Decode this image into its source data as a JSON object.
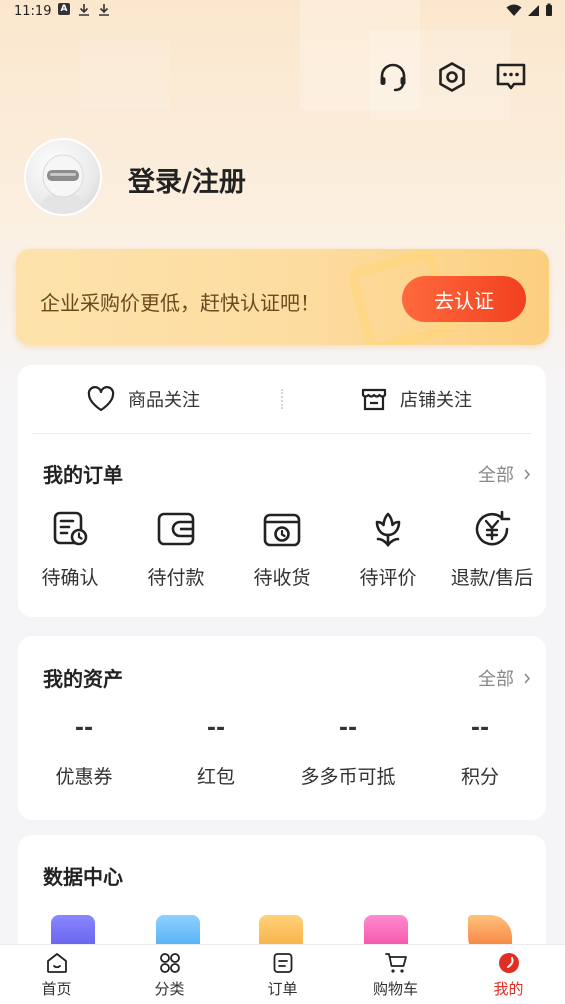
{
  "status_bar": {
    "time": "11:19"
  },
  "profile": {
    "login_text": "登录/注册"
  },
  "banner": {
    "text": "企业采购价更低，赶快认证吧！",
    "button": "去认证"
  },
  "follow": {
    "goods": "商品关注",
    "store": "店铺关注"
  },
  "orders": {
    "title": "我的订单",
    "more": "全部",
    "items": [
      {
        "label": "待确认",
        "icon": "confirm-icon"
      },
      {
        "label": "待付款",
        "icon": "wallet-icon"
      },
      {
        "label": "待收货",
        "icon": "receive-icon"
      },
      {
        "label": "待评价",
        "icon": "review-icon"
      },
      {
        "label": "退款/售后",
        "icon": "refund-icon"
      }
    ]
  },
  "assets": {
    "title": "我的资产",
    "more": "全部",
    "items": [
      {
        "value": "--",
        "label": "优惠券"
      },
      {
        "value": "--",
        "label": "红包"
      },
      {
        "value": "--",
        "label": "多多币可抵"
      },
      {
        "value": "--",
        "label": "积分"
      }
    ]
  },
  "data_center": {
    "title": "数据中心"
  },
  "tabs": [
    {
      "label": "首页",
      "icon": "home-icon"
    },
    {
      "label": "分类",
      "icon": "category-icon"
    },
    {
      "label": "订单",
      "icon": "order-icon"
    },
    {
      "label": "购物车",
      "icon": "cart-icon"
    },
    {
      "label": "我的",
      "icon": "profile-icon",
      "active": true
    }
  ],
  "colors": {
    "accent": "#e02e24",
    "banner_button": "#f2401f",
    "banner_text": "#6b4a1f"
  }
}
